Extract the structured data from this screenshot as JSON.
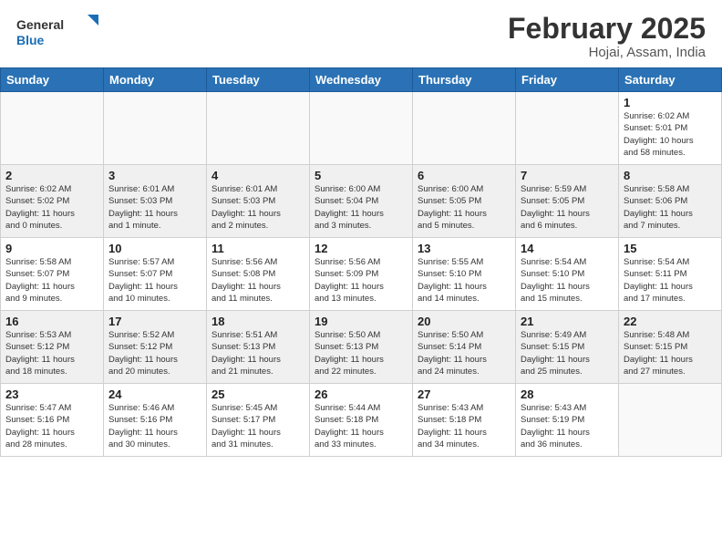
{
  "header": {
    "logo_general": "General",
    "logo_blue": "Blue",
    "title": "February 2025",
    "subtitle": "Hojai, Assam, India"
  },
  "weekdays": [
    "Sunday",
    "Monday",
    "Tuesday",
    "Wednesday",
    "Thursday",
    "Friday",
    "Saturday"
  ],
  "weeks": [
    [
      {
        "day": "",
        "info": ""
      },
      {
        "day": "",
        "info": ""
      },
      {
        "day": "",
        "info": ""
      },
      {
        "day": "",
        "info": ""
      },
      {
        "day": "",
        "info": ""
      },
      {
        "day": "",
        "info": ""
      },
      {
        "day": "1",
        "info": "Sunrise: 6:02 AM\nSunset: 5:01 PM\nDaylight: 10 hours\nand 58 minutes."
      }
    ],
    [
      {
        "day": "2",
        "info": "Sunrise: 6:02 AM\nSunset: 5:02 PM\nDaylight: 11 hours\nand 0 minutes."
      },
      {
        "day": "3",
        "info": "Sunrise: 6:01 AM\nSunset: 5:03 PM\nDaylight: 11 hours\nand 1 minute."
      },
      {
        "day": "4",
        "info": "Sunrise: 6:01 AM\nSunset: 5:03 PM\nDaylight: 11 hours\nand 2 minutes."
      },
      {
        "day": "5",
        "info": "Sunrise: 6:00 AM\nSunset: 5:04 PM\nDaylight: 11 hours\nand 3 minutes."
      },
      {
        "day": "6",
        "info": "Sunrise: 6:00 AM\nSunset: 5:05 PM\nDaylight: 11 hours\nand 5 minutes."
      },
      {
        "day": "7",
        "info": "Sunrise: 5:59 AM\nSunset: 5:05 PM\nDaylight: 11 hours\nand 6 minutes."
      },
      {
        "day": "8",
        "info": "Sunrise: 5:58 AM\nSunset: 5:06 PM\nDaylight: 11 hours\nand 7 minutes."
      }
    ],
    [
      {
        "day": "9",
        "info": "Sunrise: 5:58 AM\nSunset: 5:07 PM\nDaylight: 11 hours\nand 9 minutes."
      },
      {
        "day": "10",
        "info": "Sunrise: 5:57 AM\nSunset: 5:07 PM\nDaylight: 11 hours\nand 10 minutes."
      },
      {
        "day": "11",
        "info": "Sunrise: 5:56 AM\nSunset: 5:08 PM\nDaylight: 11 hours\nand 11 minutes."
      },
      {
        "day": "12",
        "info": "Sunrise: 5:56 AM\nSunset: 5:09 PM\nDaylight: 11 hours\nand 13 minutes."
      },
      {
        "day": "13",
        "info": "Sunrise: 5:55 AM\nSunset: 5:10 PM\nDaylight: 11 hours\nand 14 minutes."
      },
      {
        "day": "14",
        "info": "Sunrise: 5:54 AM\nSunset: 5:10 PM\nDaylight: 11 hours\nand 15 minutes."
      },
      {
        "day": "15",
        "info": "Sunrise: 5:54 AM\nSunset: 5:11 PM\nDaylight: 11 hours\nand 17 minutes."
      }
    ],
    [
      {
        "day": "16",
        "info": "Sunrise: 5:53 AM\nSunset: 5:12 PM\nDaylight: 11 hours\nand 18 minutes."
      },
      {
        "day": "17",
        "info": "Sunrise: 5:52 AM\nSunset: 5:12 PM\nDaylight: 11 hours\nand 20 minutes."
      },
      {
        "day": "18",
        "info": "Sunrise: 5:51 AM\nSunset: 5:13 PM\nDaylight: 11 hours\nand 21 minutes."
      },
      {
        "day": "19",
        "info": "Sunrise: 5:50 AM\nSunset: 5:13 PM\nDaylight: 11 hours\nand 22 minutes."
      },
      {
        "day": "20",
        "info": "Sunrise: 5:50 AM\nSunset: 5:14 PM\nDaylight: 11 hours\nand 24 minutes."
      },
      {
        "day": "21",
        "info": "Sunrise: 5:49 AM\nSunset: 5:15 PM\nDaylight: 11 hours\nand 25 minutes."
      },
      {
        "day": "22",
        "info": "Sunrise: 5:48 AM\nSunset: 5:15 PM\nDaylight: 11 hours\nand 27 minutes."
      }
    ],
    [
      {
        "day": "23",
        "info": "Sunrise: 5:47 AM\nSunset: 5:16 PM\nDaylight: 11 hours\nand 28 minutes."
      },
      {
        "day": "24",
        "info": "Sunrise: 5:46 AM\nSunset: 5:16 PM\nDaylight: 11 hours\nand 30 minutes."
      },
      {
        "day": "25",
        "info": "Sunrise: 5:45 AM\nSunset: 5:17 PM\nDaylight: 11 hours\nand 31 minutes."
      },
      {
        "day": "26",
        "info": "Sunrise: 5:44 AM\nSunset: 5:18 PM\nDaylight: 11 hours\nand 33 minutes."
      },
      {
        "day": "27",
        "info": "Sunrise: 5:43 AM\nSunset: 5:18 PM\nDaylight: 11 hours\nand 34 minutes."
      },
      {
        "day": "28",
        "info": "Sunrise: 5:43 AM\nSunset: 5:19 PM\nDaylight: 11 hours\nand 36 minutes."
      },
      {
        "day": "",
        "info": ""
      }
    ]
  ]
}
